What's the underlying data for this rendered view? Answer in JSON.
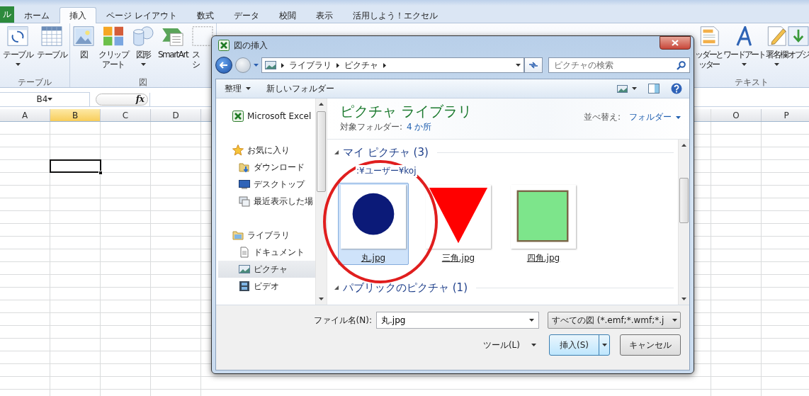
{
  "excel": {
    "file_tab": "ル",
    "tabs": [
      {
        "label": "ホーム",
        "selected": false
      },
      {
        "label": "挿入",
        "selected": true
      },
      {
        "label": "ページ レイアウト",
        "selected": false
      },
      {
        "label": "数式",
        "selected": false
      },
      {
        "label": "データ",
        "selected": false
      },
      {
        "label": "校閲",
        "selected": false
      },
      {
        "label": "表示",
        "selected": false
      },
      {
        "label": "活用しよう！エクセル",
        "selected": false
      }
    ],
    "ribbon_left": [
      {
        "label": "テーブル",
        "items": [
          {
            "kind": "pivot",
            "lines": [
              "テーブル"
            ],
            "dropdown": true
          },
          {
            "kind": "table",
            "lines": [
              "テーブル"
            ],
            "dropdown": false
          }
        ]
      },
      {
        "label": "図",
        "items": [
          {
            "kind": "picture",
            "lines": [
              "図"
            ],
            "dropdown": false
          },
          {
            "kind": "clipart",
            "lines": [
              "クリップ",
              "アート"
            ],
            "dropdown": false
          },
          {
            "kind": "shapes",
            "lines": [
              "図形"
            ],
            "dropdown": true
          },
          {
            "kind": "smartart",
            "lines": [
              "SmartArt"
            ],
            "dropdown": false
          },
          {
            "kind": "screenshot",
            "lines": [
              "ス",
              "シ"
            ],
            "dropdown": false
          }
        ]
      }
    ],
    "ribbon_right": {
      "label": "テキスト",
      "items": [
        {
          "kind": "header",
          "lines": [
            "ッダーと",
            "ッター"
          ],
          "dropdown": false
        },
        {
          "kind": "wordart",
          "lines": [
            "ワードアート"
          ],
          "dropdown": true
        },
        {
          "kind": "signature",
          "lines": [
            "署名欄"
          ],
          "dropdown": true
        },
        {
          "kind": "object",
          "lines": [
            "オブジ"
          ],
          "dropdown": false
        }
      ]
    },
    "name_box": "B4",
    "function_label": "fx",
    "columns_left": [
      {
        "label": "A",
        "selected": false
      },
      {
        "label": "B",
        "selected": true
      },
      {
        "label": "C",
        "selected": false
      },
      {
        "label": "D",
        "selected": false
      }
    ],
    "columns_right": [
      {
        "label": "O",
        "selected": false
      },
      {
        "label": "P",
        "selected": false
      }
    ],
    "rows": [
      {
        "selected": false
      },
      {
        "selected": false
      },
      {
        "selected": false
      },
      {
        "selected": true
      },
      {
        "selected": false
      },
      {
        "selected": false
      },
      {
        "selected": false
      },
      {
        "selected": false
      },
      {
        "selected": false
      },
      {
        "selected": false
      },
      {
        "selected": false
      },
      {
        "selected": false
      },
      {
        "selected": false
      },
      {
        "selected": false
      },
      {
        "selected": false
      },
      {
        "selected": false
      },
      {
        "selected": false
      },
      {
        "selected": false
      },
      {
        "selected": false
      },
      {
        "selected": false
      },
      {
        "selected": false
      },
      {
        "selected": false
      }
    ]
  },
  "dialog": {
    "title": "図の挿入",
    "breadcrumbs": [
      "ライブラリ",
      "ピクチャ"
    ],
    "search_placeholder": "ピクチャの検索",
    "organize": "整理",
    "new_folder": "新しいフォルダー",
    "nav": [
      {
        "label": "Microsoft Excel",
        "kind": "excel",
        "selected": false
      },
      {
        "label": "お気に入り",
        "kind": "star",
        "selected": false,
        "children": [
          {
            "label": "ダウンロード",
            "kind": "download",
            "selected": false
          },
          {
            "label": "デスクトップ",
            "kind": "desktop",
            "selected": false
          },
          {
            "label": "最近表示した場",
            "kind": "recent",
            "selected": false
          }
        ]
      },
      {
        "label": "ライブラリ",
        "kind": "library",
        "selected": false,
        "children": [
          {
            "label": "ドキュメント",
            "kind": "document",
            "selected": false
          },
          {
            "label": "ピクチャ",
            "kind": "pictures",
            "selected": true
          },
          {
            "label": "ビデオ",
            "kind": "video",
            "selected": false
          }
        ]
      }
    ],
    "library_title": "ピクチャ ライブラリ",
    "folders_label": "対象フォルダー:",
    "folders_link": "4 か所",
    "sort_label": "並べ替え:",
    "sort_value": "フォルダー",
    "groups": [
      {
        "title": "マイ ピクチャ (3)",
        "path": ":¥ユーザー¥koj",
        "expanded": true,
        "files": [
          {
            "name": "丸.jpg",
            "kind": "circle",
            "selected": true
          },
          {
            "name": "三角.jpg",
            "kind": "triangle",
            "selected": false
          },
          {
            "name": "四角.jpg",
            "kind": "square",
            "selected": false
          }
        ]
      },
      {
        "title": "パブリックのピクチャ (1)",
        "expanded": true
      }
    ],
    "file_name_label": "ファイル名(N):",
    "file_name": "丸.jpg",
    "filter": "すべての図 (*.emf;*.wmf;*.j",
    "tools": "ツール(L)",
    "insert": "挿入(S)",
    "cancel": "キャンセル"
  }
}
